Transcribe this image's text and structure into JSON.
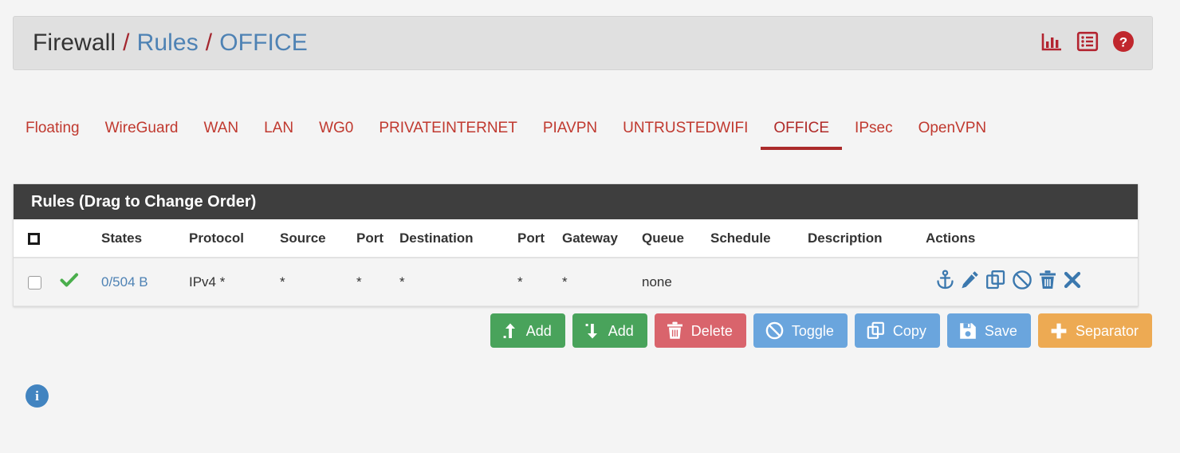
{
  "breadcrumb": {
    "root": "Firewall",
    "section": "Rules",
    "interface": "OFFICE",
    "separator": "/"
  },
  "header_icons": [
    {
      "name": "bar-chart-icon",
      "label": "Traffic Graph"
    },
    {
      "name": "list-icon",
      "label": "Rules List"
    },
    {
      "name": "help-icon",
      "label": "Help"
    }
  ],
  "accent_colors": {
    "tab_red": "#c0392f",
    "active_underline": "#ab2b2b",
    "link_blue": "#4e82b4",
    "panel_header": "#3e3e3e",
    "pass_green": "#49a35b",
    "button_blue": "#6aa5dd",
    "button_red": "#d9646c",
    "button_orange": "#edaa53",
    "info_blue": "#4284c0"
  },
  "tabs": [
    {
      "label": "Floating",
      "active": false
    },
    {
      "label": "WireGuard",
      "active": false
    },
    {
      "label": "WAN",
      "active": false
    },
    {
      "label": "LAN",
      "active": false
    },
    {
      "label": "WG0",
      "active": false
    },
    {
      "label": "PRIVATEINTERNET",
      "active": false
    },
    {
      "label": "PIAVPN",
      "active": false
    },
    {
      "label": "UNTRUSTEDWIFI",
      "active": false
    },
    {
      "label": "OFFICE",
      "active": true
    },
    {
      "label": "IPsec",
      "active": false
    },
    {
      "label": "OpenVPN",
      "active": false
    }
  ],
  "panel": {
    "title": "Rules (Drag to Change Order)",
    "columns": [
      "",
      "",
      "States",
      "Protocol",
      "Source",
      "Port",
      "Destination",
      "Port",
      "Gateway",
      "Queue",
      "Schedule",
      "Description",
      "Actions"
    ],
    "rows": [
      {
        "selected": false,
        "status": "pass",
        "states": "0/504 B",
        "protocol": "IPv4 *",
        "source": "*",
        "source_port": "*",
        "destination": "*",
        "destination_port": "*",
        "gateway": "*",
        "queue": "none",
        "schedule": "",
        "description": "",
        "actions": [
          "anchor-icon",
          "edit-icon",
          "copy-icon",
          "disable-icon",
          "delete-icon",
          "remove-icon"
        ]
      }
    ]
  },
  "buttons": [
    {
      "label": "Add",
      "icon": "arrow-up-icon",
      "style": "green",
      "name": "add-rule-top-button"
    },
    {
      "label": "Add",
      "icon": "arrow-down-icon",
      "style": "green",
      "name": "add-rule-bottom-button"
    },
    {
      "label": "Delete",
      "icon": "trash-icon",
      "style": "red",
      "name": "delete-button"
    },
    {
      "label": "Toggle",
      "icon": "ban-icon",
      "style": "blue",
      "name": "toggle-button"
    },
    {
      "label": "Copy",
      "icon": "copy-icon",
      "style": "blue",
      "name": "copy-button"
    },
    {
      "label": "Save",
      "icon": "save-icon",
      "style": "blue",
      "name": "save-button"
    },
    {
      "label": "Separator",
      "icon": "plus-icon",
      "style": "orange",
      "name": "separator-button"
    }
  ],
  "footer": {
    "info_glyph": "i"
  }
}
